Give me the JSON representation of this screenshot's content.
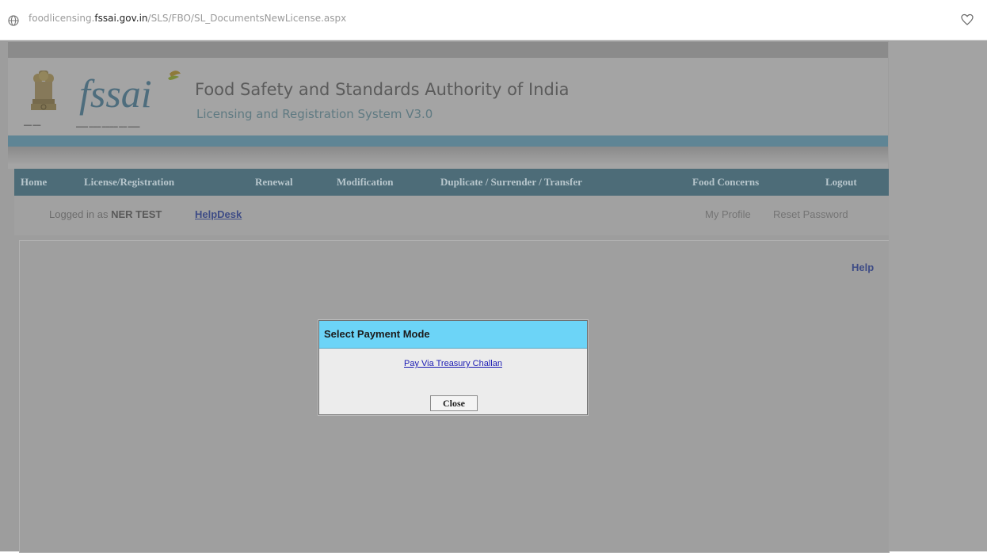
{
  "browser": {
    "url_prefix": "foodlicensing.",
    "url_domain": "fssai.gov.in",
    "url_path": "/SLS/FBO/SL_DocumentsNewLicense.aspx"
  },
  "header": {
    "logo_text": "fssai",
    "org_title": "Food Safety and Standards Authority of India",
    "system_title": "Licensing and Registration System V3.0"
  },
  "nav": {
    "items": [
      {
        "label": "Home"
      },
      {
        "label": "License/Registration"
      },
      {
        "label": "Renewal"
      },
      {
        "label": "Modification"
      },
      {
        "label": "Duplicate / Surrender / Transfer"
      },
      {
        "label": "Food Concerns"
      },
      {
        "label": "Logout"
      }
    ]
  },
  "user": {
    "logged_in_prefix": "Logged in as",
    "user_name": "NER TEST",
    "helpdesk": "HelpDesk",
    "my_profile": "My Profile",
    "reset_password": "Reset Password"
  },
  "content": {
    "help_link": "Help"
  },
  "modal": {
    "title": "Select Payment Mode",
    "pay_link": "Pay Via Treasury Challan",
    "close_label": "Close"
  },
  "colors": {
    "modal_header": "#6cd4f7",
    "nav_bar": "#4d6c78",
    "stripe": "#5f8595"
  }
}
